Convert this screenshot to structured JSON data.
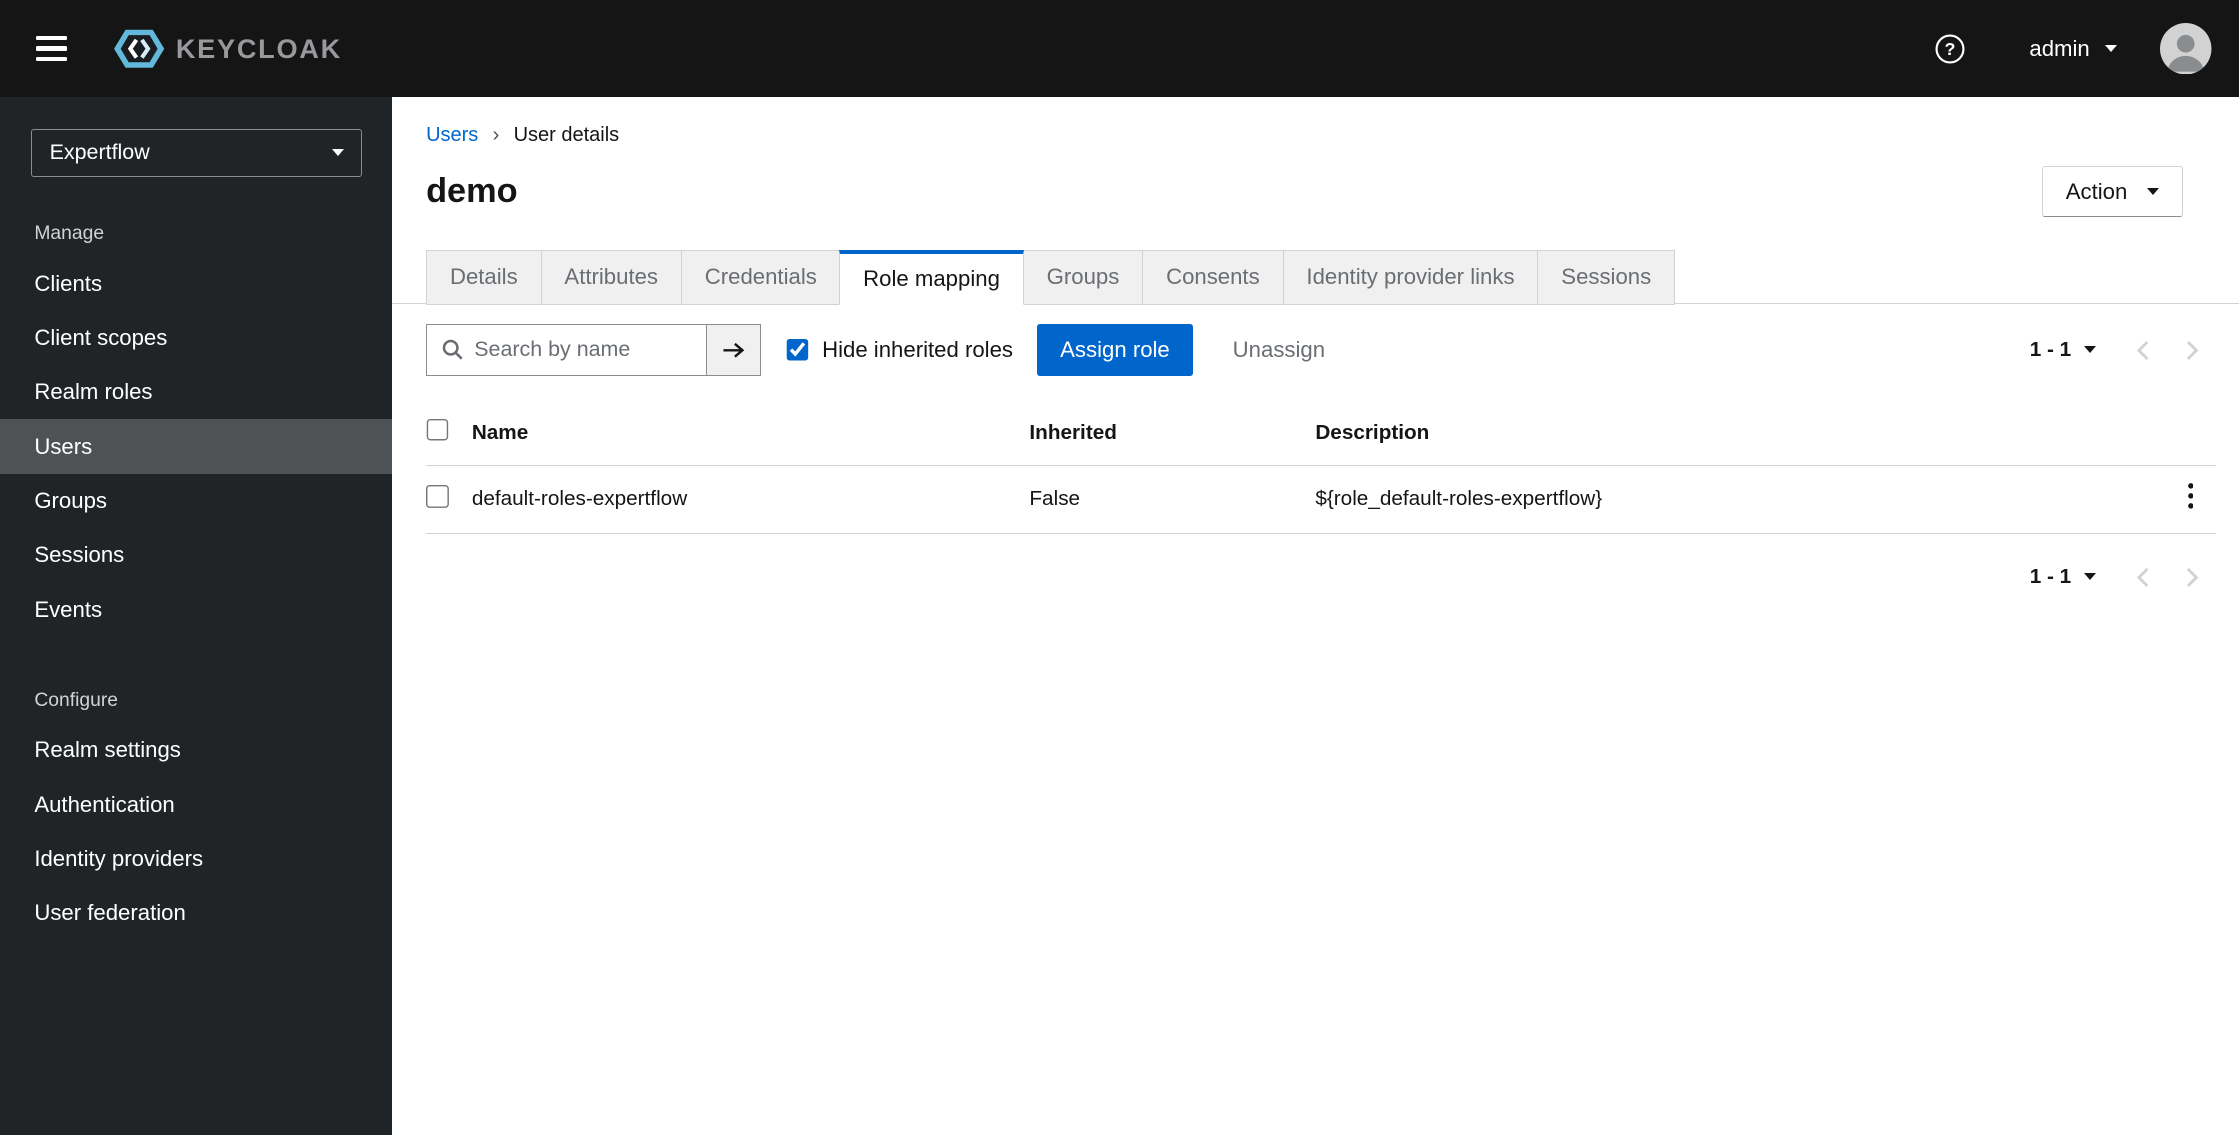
{
  "masthead": {
    "brand_text": "KEYCLOAK",
    "username": "admin"
  },
  "icons": {
    "help_glyph": "?",
    "hamburger": "menu-bars",
    "search": "magnifier",
    "search_submit": "arrow-right",
    "kebab": "vertical-ellipsis",
    "pagination_prev": "chevron-left",
    "pagination_next": "chevron-right",
    "dropdown": "chevron-down"
  },
  "sidebar": {
    "realm_name": "Expertflow",
    "selected_item": "Users",
    "groups": [
      {
        "label": "Manage",
        "items": [
          "Clients",
          "Client scopes",
          "Realm roles",
          "Users",
          "Groups",
          "Sessions",
          "Events"
        ]
      },
      {
        "label": "Configure",
        "items": [
          "Realm settings",
          "Authentication",
          "Identity providers",
          "User federation"
        ]
      }
    ]
  },
  "breadcrumb": {
    "separator": "›",
    "items": [
      "Users",
      "User details"
    ]
  },
  "page": {
    "title": "demo",
    "action_button_label": "Action"
  },
  "tabs": {
    "active": "Role mapping",
    "items": [
      "Details",
      "Attributes",
      "Credentials",
      "Role mapping",
      "Groups",
      "Consents",
      "Identity provider links",
      "Sessions"
    ]
  },
  "toolbar": {
    "search_placeholder": "Search by name",
    "hide_inherited_label": "Hide inherited roles",
    "hide_inherited_checked": true,
    "assign_button_label": "Assign role",
    "unassign_button_label": "Unassign",
    "pagination_range": "1 - 1"
  },
  "table": {
    "headers": [
      "Name",
      "Inherited",
      "Description"
    ],
    "rows": [
      {
        "name": "default-roles-expertflow",
        "inherited": "False",
        "description": "${role_default-roles-expertflow}"
      }
    ]
  },
  "bottom_pagination": {
    "range": "1 - 1"
  },
  "colors": {
    "primary": "#0066cc",
    "link": "#0066cc",
    "masthead_bg": "#151515",
    "sidebar_bg": "#212427",
    "nav_selected_bg": "#4f5255",
    "tab_active_accent": "#0066cc",
    "tab_inactive_bg": "#f0f0f0",
    "border": "#d2d2d2"
  }
}
